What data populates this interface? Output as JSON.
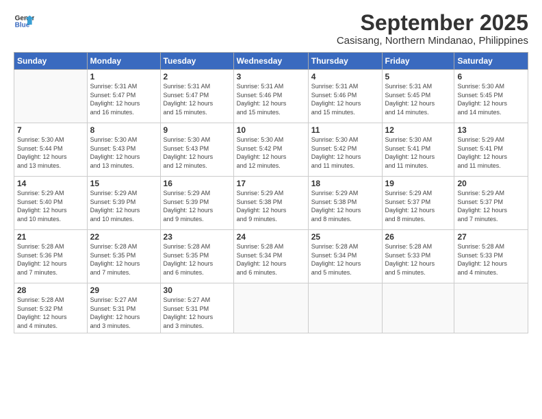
{
  "logo": {
    "line1": "General",
    "line2": "Blue"
  },
  "title": "September 2025",
  "subtitle": "Casisang, Northern Mindanao, Philippines",
  "weekdays": [
    "Sunday",
    "Monday",
    "Tuesday",
    "Wednesday",
    "Thursday",
    "Friday",
    "Saturday"
  ],
  "weeks": [
    [
      {
        "num": "",
        "info": ""
      },
      {
        "num": "1",
        "info": "Sunrise: 5:31 AM\nSunset: 5:47 PM\nDaylight: 12 hours\nand 16 minutes."
      },
      {
        "num": "2",
        "info": "Sunrise: 5:31 AM\nSunset: 5:47 PM\nDaylight: 12 hours\nand 15 minutes."
      },
      {
        "num": "3",
        "info": "Sunrise: 5:31 AM\nSunset: 5:46 PM\nDaylight: 12 hours\nand 15 minutes."
      },
      {
        "num": "4",
        "info": "Sunrise: 5:31 AM\nSunset: 5:46 PM\nDaylight: 12 hours\nand 15 minutes."
      },
      {
        "num": "5",
        "info": "Sunrise: 5:31 AM\nSunset: 5:45 PM\nDaylight: 12 hours\nand 14 minutes."
      },
      {
        "num": "6",
        "info": "Sunrise: 5:30 AM\nSunset: 5:45 PM\nDaylight: 12 hours\nand 14 minutes."
      }
    ],
    [
      {
        "num": "7",
        "info": "Sunrise: 5:30 AM\nSunset: 5:44 PM\nDaylight: 12 hours\nand 13 minutes."
      },
      {
        "num": "8",
        "info": "Sunrise: 5:30 AM\nSunset: 5:43 PM\nDaylight: 12 hours\nand 13 minutes."
      },
      {
        "num": "9",
        "info": "Sunrise: 5:30 AM\nSunset: 5:43 PM\nDaylight: 12 hours\nand 12 minutes."
      },
      {
        "num": "10",
        "info": "Sunrise: 5:30 AM\nSunset: 5:42 PM\nDaylight: 12 hours\nand 12 minutes."
      },
      {
        "num": "11",
        "info": "Sunrise: 5:30 AM\nSunset: 5:42 PM\nDaylight: 12 hours\nand 11 minutes."
      },
      {
        "num": "12",
        "info": "Sunrise: 5:30 AM\nSunset: 5:41 PM\nDaylight: 12 hours\nand 11 minutes."
      },
      {
        "num": "13",
        "info": "Sunrise: 5:29 AM\nSunset: 5:41 PM\nDaylight: 12 hours\nand 11 minutes."
      }
    ],
    [
      {
        "num": "14",
        "info": "Sunrise: 5:29 AM\nSunset: 5:40 PM\nDaylight: 12 hours\nand 10 minutes."
      },
      {
        "num": "15",
        "info": "Sunrise: 5:29 AM\nSunset: 5:39 PM\nDaylight: 12 hours\nand 10 minutes."
      },
      {
        "num": "16",
        "info": "Sunrise: 5:29 AM\nSunset: 5:39 PM\nDaylight: 12 hours\nand 9 minutes."
      },
      {
        "num": "17",
        "info": "Sunrise: 5:29 AM\nSunset: 5:38 PM\nDaylight: 12 hours\nand 9 minutes."
      },
      {
        "num": "18",
        "info": "Sunrise: 5:29 AM\nSunset: 5:38 PM\nDaylight: 12 hours\nand 8 minutes."
      },
      {
        "num": "19",
        "info": "Sunrise: 5:29 AM\nSunset: 5:37 PM\nDaylight: 12 hours\nand 8 minutes."
      },
      {
        "num": "20",
        "info": "Sunrise: 5:29 AM\nSunset: 5:37 PM\nDaylight: 12 hours\nand 7 minutes."
      }
    ],
    [
      {
        "num": "21",
        "info": "Sunrise: 5:28 AM\nSunset: 5:36 PM\nDaylight: 12 hours\nand 7 minutes."
      },
      {
        "num": "22",
        "info": "Sunrise: 5:28 AM\nSunset: 5:35 PM\nDaylight: 12 hours\nand 7 minutes."
      },
      {
        "num": "23",
        "info": "Sunrise: 5:28 AM\nSunset: 5:35 PM\nDaylight: 12 hours\nand 6 minutes."
      },
      {
        "num": "24",
        "info": "Sunrise: 5:28 AM\nSunset: 5:34 PM\nDaylight: 12 hours\nand 6 minutes."
      },
      {
        "num": "25",
        "info": "Sunrise: 5:28 AM\nSunset: 5:34 PM\nDaylight: 12 hours\nand 5 minutes."
      },
      {
        "num": "26",
        "info": "Sunrise: 5:28 AM\nSunset: 5:33 PM\nDaylight: 12 hours\nand 5 minutes."
      },
      {
        "num": "27",
        "info": "Sunrise: 5:28 AM\nSunset: 5:33 PM\nDaylight: 12 hours\nand 4 minutes."
      }
    ],
    [
      {
        "num": "28",
        "info": "Sunrise: 5:28 AM\nSunset: 5:32 PM\nDaylight: 12 hours\nand 4 minutes."
      },
      {
        "num": "29",
        "info": "Sunrise: 5:27 AM\nSunset: 5:31 PM\nDaylight: 12 hours\nand 3 minutes."
      },
      {
        "num": "30",
        "info": "Sunrise: 5:27 AM\nSunset: 5:31 PM\nDaylight: 12 hours\nand 3 minutes."
      },
      {
        "num": "",
        "info": ""
      },
      {
        "num": "",
        "info": ""
      },
      {
        "num": "",
        "info": ""
      },
      {
        "num": "",
        "info": ""
      }
    ]
  ]
}
